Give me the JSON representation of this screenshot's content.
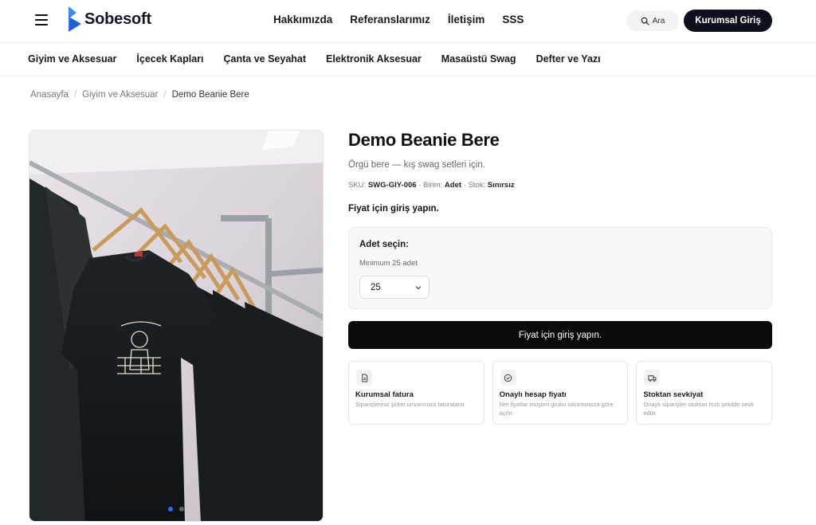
{
  "header": {
    "brand": "Sobesoft",
    "nav": [
      "Hakkımızda",
      "Referanslarımız",
      "İletişim",
      "SSS"
    ],
    "search_label": "Ara",
    "login_label": "Kurumsal Giriş"
  },
  "categories": [
    "Giyim ve Aksesuar",
    "İçecek Kapları",
    "Çanta ve Seyahat",
    "Elektronik Aksesuar",
    "Masaüstü Swag",
    "Defter ve Yazı"
  ],
  "breadcrumb": [
    "Anasayfa",
    "Giyim ve Aksesuar",
    "Demo Beanie Bere"
  ],
  "product": {
    "title": "Demo Beanie Bere",
    "description": "Örgü bere — kış swag setleri için.",
    "sku_label": "SKU:",
    "sku": "SWG-GIY-006",
    "unit_label": "Birim:",
    "unit": "Adet",
    "stock_label": "Stok:",
    "stock": "Sınırsız",
    "price_note": "Fiyat için giriş yapın.",
    "image_slides": 2,
    "active_slide": 1
  },
  "quantity": {
    "label": "Adet seçin:",
    "minimum": "Minimum 25 adet",
    "selected": "25"
  },
  "cta_label": "Fiyat için giriş yapın.",
  "features": [
    {
      "icon": "invoice-icon",
      "title": "Kurumsal fatura",
      "desc": "Siparişleriniz şirket unvanınıza faturalanır."
    },
    {
      "icon": "check-circle-icon",
      "title": "Onaylı hesap fiyatı",
      "desc": "Net fiyatlar müşteri grubu iskontonuza göre açılır."
    },
    {
      "icon": "truck-icon",
      "title": "Stoktan sevkiyat",
      "desc": "Onaylı siparişler stoktan hızlı şekilde sevk edilir."
    }
  ],
  "colors": {
    "primary_dark": "#0d0f1c",
    "brand_blue": "#2e6df6",
    "surface": "#f7f8f9"
  }
}
